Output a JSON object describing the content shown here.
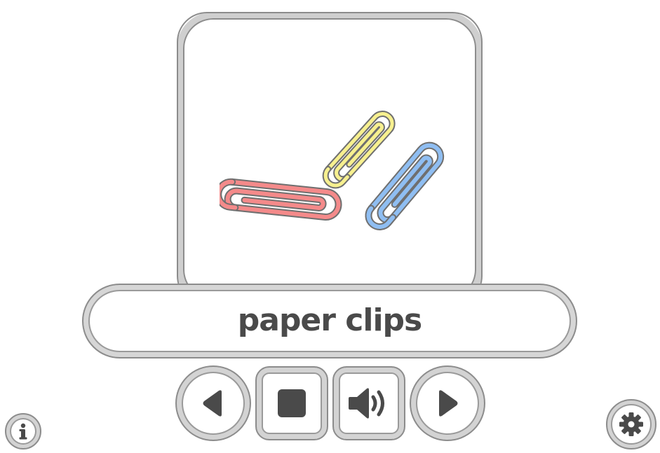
{
  "card": {
    "image_icon": "paper-clips-illustration",
    "clip_colors": [
      "#f48a8a",
      "#f7f08f",
      "#8fbef2"
    ]
  },
  "word": {
    "text": "paper clips"
  },
  "controls": {
    "previous_icon": "triangle-left-icon",
    "stop_icon": "square-stop-icon",
    "speaker_icon": "speaker-icon",
    "next_icon": "triangle-right-icon",
    "icon_color": "#4a4a4a"
  },
  "corner": {
    "info_icon": "info-icon",
    "settings_icon": "gear-icon"
  }
}
